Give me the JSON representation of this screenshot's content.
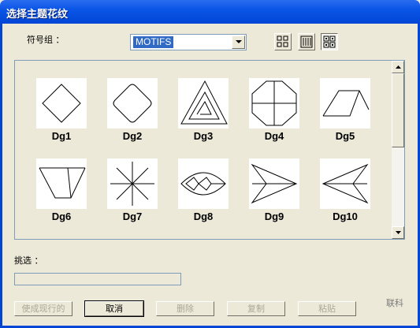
{
  "window": {
    "title": "选择主题花纹"
  },
  "symbol_group": {
    "label": "符号组 ：",
    "value": "MOTIFS"
  },
  "view_buttons": [
    {
      "icon": "large-icons-view-icon"
    },
    {
      "icon": "list-view-icon"
    },
    {
      "icon": "small-icons-view-icon",
      "pressed": true
    }
  ],
  "motifs": [
    {
      "label": "Dg1"
    },
    {
      "label": "Dg2"
    },
    {
      "label": "Dg3"
    },
    {
      "label": "Dg4"
    },
    {
      "label": "Dg5"
    },
    {
      "label": "Dg6"
    },
    {
      "label": "Dg7"
    },
    {
      "label": "Dg8"
    },
    {
      "label": "Dg9"
    },
    {
      "label": "Dg10"
    }
  ],
  "filter": {
    "label": "挑选 ：",
    "value": ""
  },
  "buttons": {
    "apply": "使成现行的",
    "cancel": "取消",
    "delete": "删除",
    "copy": "复制",
    "paste": "粘贴"
  },
  "brand": "联科",
  "colors": {
    "titlebar": "#0a55e6",
    "face": "#ece9d8",
    "selection": "#316ac5"
  }
}
